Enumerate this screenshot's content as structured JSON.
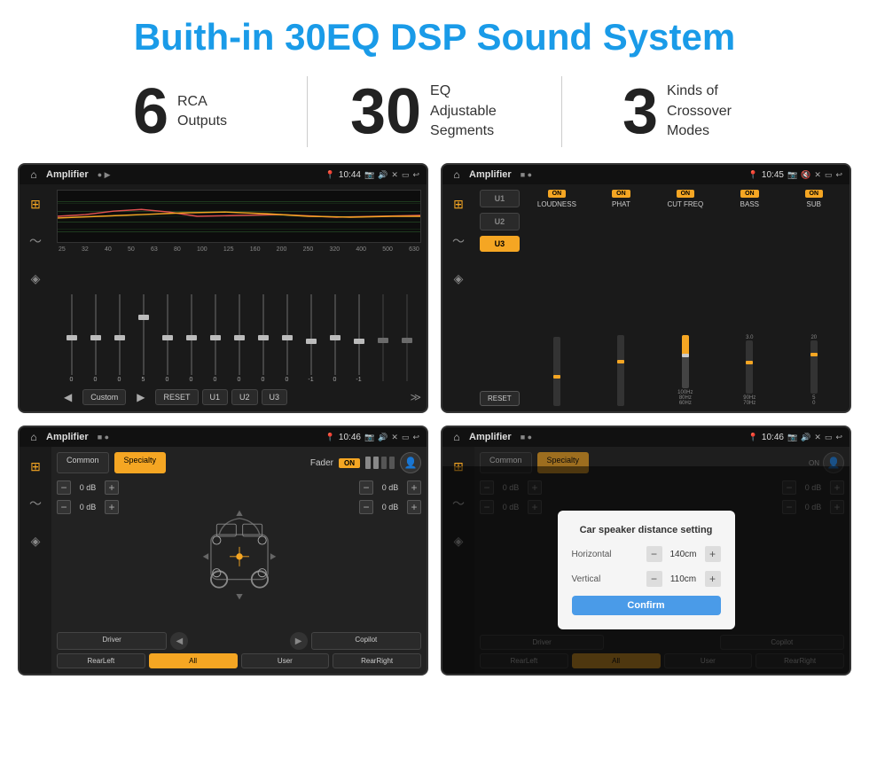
{
  "page": {
    "title": "Buith-in 30EQ DSP Sound System",
    "stats": [
      {
        "number": "6",
        "label": "RCA\nOutputs"
      },
      {
        "number": "30",
        "label": "EQ Adjustable\nSegments"
      },
      {
        "number": "3",
        "label": "Kinds of\nCrossover Modes"
      }
    ],
    "screens": [
      {
        "id": "eq-screen",
        "time": "10:44",
        "title": "Amplifier",
        "type": "eq",
        "eq_labels": [
          "25",
          "32",
          "40",
          "50",
          "63",
          "80",
          "100",
          "125",
          "160",
          "200",
          "250",
          "320",
          "400",
          "500",
          "630"
        ],
        "eq_values": [
          "0",
          "0",
          "0",
          "5",
          "0",
          "0",
          "0",
          "0",
          "0",
          "0",
          "-1",
          "0",
          "-1"
        ],
        "preset_label": "Custom",
        "buttons": [
          "RESET",
          "U1",
          "U2",
          "U3"
        ]
      },
      {
        "id": "crossover-screen",
        "time": "10:45",
        "title": "Amplifier",
        "type": "crossover",
        "channels": [
          "U1",
          "U2",
          "U3"
        ],
        "channel_labels": [
          "LOUDNESS",
          "PHAT",
          "CUT FREQ",
          "BASS",
          "SUB"
        ],
        "on_badges": [
          "ON",
          "ON",
          "ON",
          "ON",
          "ON"
        ]
      },
      {
        "id": "fader-screen",
        "time": "10:46",
        "title": "Amplifier",
        "type": "fader",
        "tabs": [
          "Common",
          "Specialty"
        ],
        "fader_label": "Fader",
        "fader_on": "ON",
        "db_values": [
          "0 dB",
          "0 dB",
          "0 dB",
          "0 dB"
        ],
        "bottom_btns": [
          "Driver",
          "",
          "Copilot",
          "RearLeft",
          "All",
          "User",
          "RearRight"
        ]
      },
      {
        "id": "dialog-screen",
        "time": "10:46",
        "title": "Amplifier",
        "type": "dialog",
        "tabs": [
          "Common",
          "Specialty"
        ],
        "dialog": {
          "title": "Car speaker distance setting",
          "horizontal_label": "Horizontal",
          "horizontal_value": "140cm",
          "vertical_label": "Vertical",
          "vertical_value": "110cm",
          "confirm_label": "Confirm"
        },
        "db_values": [
          "0 dB",
          "0 dB"
        ],
        "bottom_btns": [
          "Driver",
          "",
          "Copilot",
          "RearLeft",
          "All",
          "User",
          "RearRight"
        ]
      }
    ]
  }
}
